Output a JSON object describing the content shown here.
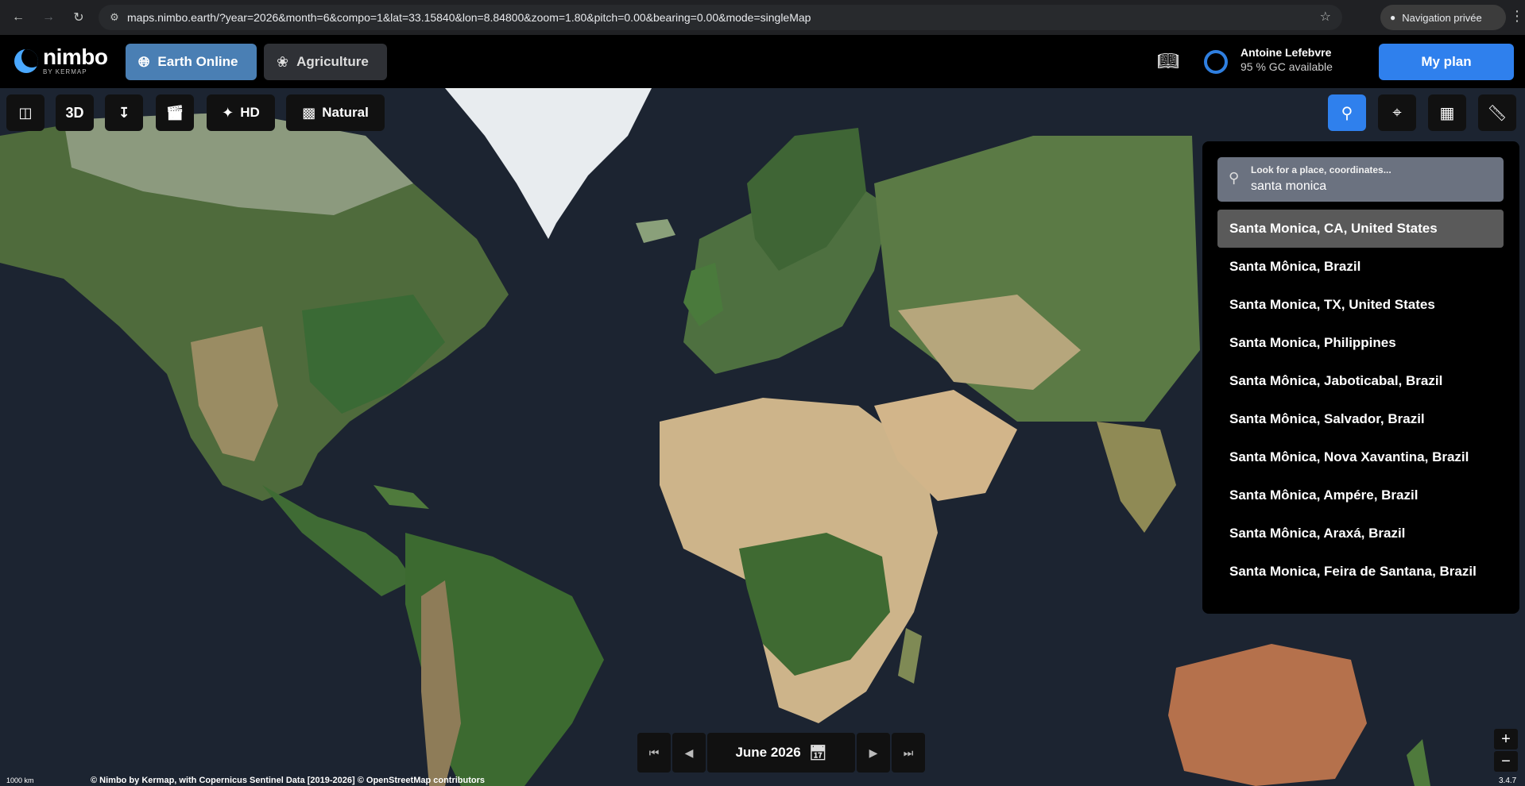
{
  "browser": {
    "url": "maps.nimbo.earth/?year=2026&month=6&compo=1&lat=33.15840&lon=8.84800&zoom=1.80&pitch=0.00&bearing=0.00&mode=singleMap",
    "private_label": "Navigation privée"
  },
  "header": {
    "logo_name": "nimbo",
    "logo_sub": "BY KERMAP",
    "tabs": [
      {
        "label": "Earth Online",
        "icon": "globe-icon",
        "active": true
      },
      {
        "label": "Agriculture",
        "icon": "leaf-icon",
        "active": false
      }
    ],
    "user_name": "Antoine Lefebvre",
    "user_gc": "95 % GC available",
    "my_plan": "My plan"
  },
  "toolbar": {
    "mode_3d": "3D",
    "hd": "HD",
    "natural": "Natural"
  },
  "search": {
    "placeholder": "Look for a place, coordinates...",
    "value": "santa monica",
    "results": [
      "Santa Monica, CA, United States",
      "Santa Mônica, Brazil",
      "Santa Monica, TX, United States",
      "Santa Monica, Philippines",
      "Santa Mônica, Jaboticabal, Brazil",
      "Santa Mônica, Salvador, Brazil",
      "Santa Mônica, Nova Xavantina, Brazil",
      "Santa Mônica, Ampére, Brazil",
      "Santa Mônica, Araxá, Brazil",
      "Santa Monica, Feira de Santana, Brazil"
    ],
    "selected_index": 0
  },
  "date": {
    "label": "June 2026"
  },
  "footer": {
    "scale": "1000 km",
    "attribution": "© Nimbo by Kermap, with Copernicus Sentinel Data [2019-2026] © OpenStreetMap contributors",
    "version": "3.4.7"
  },
  "colors": {
    "accent": "#2f80ed",
    "active_tab": "#4a7fb4",
    "ocean": "#1c2431"
  }
}
